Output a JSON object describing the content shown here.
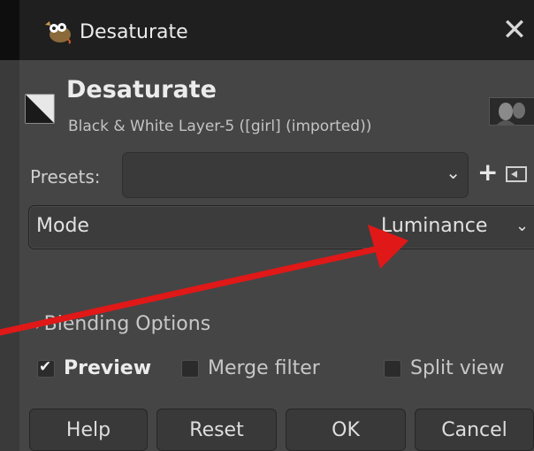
{
  "window": {
    "title": "Desaturate",
    "close_glyph": "✕"
  },
  "header": {
    "filter_name": "Desaturate",
    "layer_info": "Black & White Layer-5 ([girl] (imported))"
  },
  "presets": {
    "label": "Presets:",
    "value": "",
    "add_glyph": "+",
    "chevron": "⌄"
  },
  "mode": {
    "label": "Mode",
    "value": "Luminance",
    "chevron": "⌄"
  },
  "blending": {
    "label": "Blending Options",
    "expander": "›"
  },
  "options": {
    "preview": {
      "label": "Preview",
      "checked": true
    },
    "merge_filter": {
      "label": "Merge filter",
      "checked": false
    },
    "split_view": {
      "label": "Split view",
      "checked": false
    }
  },
  "buttons": {
    "help": "Help",
    "reset": "Reset",
    "ok": "OK",
    "cancel": "Cancel"
  },
  "colors": {
    "background": "#454545",
    "titlebar": "#1f1f1f",
    "annotation_arrow": "#e01818"
  },
  "icons": [
    "gimp-wilber-icon",
    "close-icon",
    "desaturate-filter-icon",
    "layer-thumbnail",
    "chevron-down-icon",
    "add-preset-icon",
    "manage-presets-icon",
    "checkbox-icon"
  ]
}
